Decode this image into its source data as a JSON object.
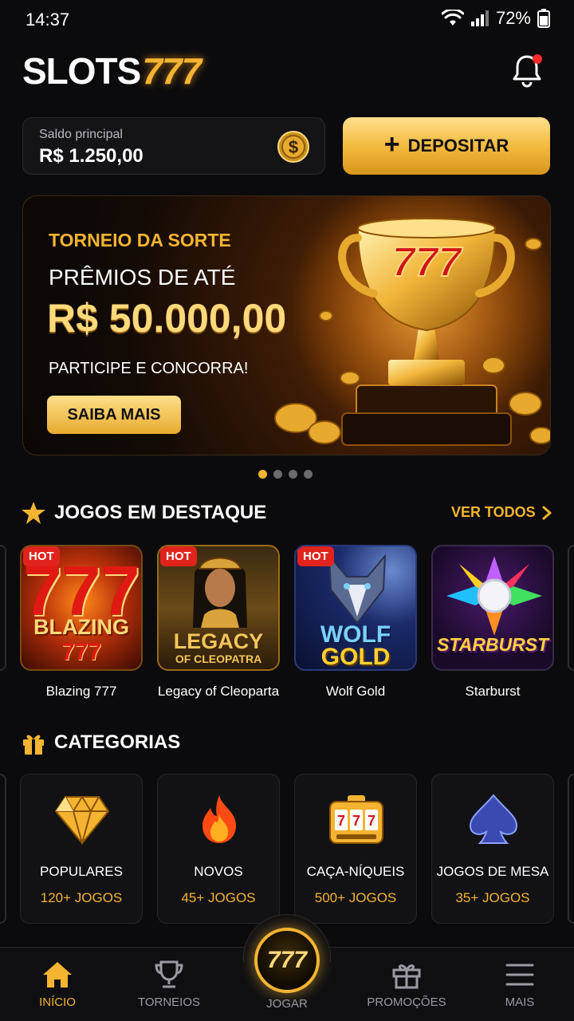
{
  "status": {
    "time": "14:37",
    "battery": "72%"
  },
  "header": {
    "logo_text": "SLOTS",
    "logo_number": "777"
  },
  "balance": {
    "label": "Saldo principal",
    "value": "R$ 1.250,00"
  },
  "deposit": {
    "label": "DEPOSITAR"
  },
  "banner": {
    "kicker": "TORNEIO DA SORTE",
    "line": "PRÊMIOS DE ATÉ",
    "amount": "R$ 50.000,00",
    "sub": "PARTICIPE E CONCORRA!",
    "button": "SAIBA MAIS",
    "trophy_text": "777"
  },
  "featured": {
    "title": "JOGOS EM DESTAQUE",
    "see_all": "VER TODOS",
    "hot_label": "HOT",
    "games": [
      {
        "name": "Blazing 777",
        "thumb_top": "BLAZING",
        "thumb_bottom": "777",
        "hot": true
      },
      {
        "name": "Legacy of Cleoparta",
        "thumb_top": "LEGACY",
        "thumb_bottom": "OF CLEOPATRA",
        "hot": true
      },
      {
        "name": "Wolf Gold",
        "thumb_top": "WOLF",
        "thumb_bottom": "GOLD",
        "hot": true
      },
      {
        "name": "Starburst",
        "thumb_top": "STARBURST",
        "hot": false
      }
    ]
  },
  "categories": {
    "title": "CATEGORIAS",
    "items": [
      {
        "name": "POPULARES",
        "count": "120+ JOGOS",
        "icon": "diamond-icon"
      },
      {
        "name": "NOVOS",
        "count": "45+ JOGOS",
        "icon": "fire-icon"
      },
      {
        "name": "CAÇA-NÍQUEIS",
        "count": "500+ JOGOS",
        "icon": "slot-machine-icon"
      },
      {
        "name": "JOGOS DE MESA",
        "count": "35+ JOGOS",
        "icon": "spade-icon"
      }
    ]
  },
  "nav": {
    "home": "INÍCIO",
    "tournaments": "TORNEIOS",
    "play": "JOGAR",
    "play_badge": "777",
    "promotions": "PROMOÇÕES",
    "more": "MAIS"
  },
  "colors": {
    "accent": "#f4b431",
    "background": "#0b0b0d",
    "hot": "#e0241d"
  }
}
